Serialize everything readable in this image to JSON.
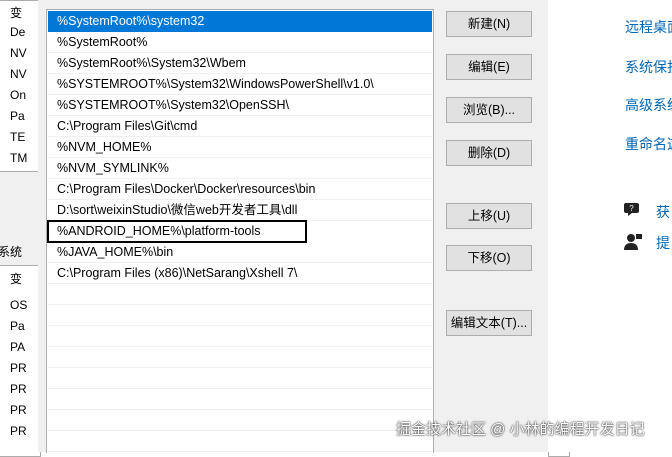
{
  "background_window": {
    "top_rows": [
      "变",
      "De",
      "NV",
      "NV",
      "On",
      "Pa",
      "TE",
      "TM"
    ],
    "section_label": "系统",
    "bottom_rows": [
      "变",
      "OS",
      "Pa",
      "PA",
      "PR",
      "PR",
      "PR",
      "PR"
    ]
  },
  "dialog": {
    "path_entries": [
      "%SystemRoot%\\system32",
      "%SystemRoot%",
      "%SystemRoot%\\System32\\Wbem",
      "%SYSTEMROOT%\\System32\\WindowsPowerShell\\v1.0\\",
      "%SYSTEMROOT%\\System32\\OpenSSH\\",
      "C:\\Program Files\\Git\\cmd",
      "%NVM_HOME%",
      "%NVM_SYMLINK%",
      "C:\\Program Files\\Docker\\Docker\\resources\\bin",
      "D:\\sort\\weixinStudio\\微信web开发者工具\\dll",
      "%ANDROID_HOME%\\platform-tools",
      "%JAVA_HOME%\\bin",
      "C:\\Program Files (x86)\\NetSarang\\Xshell 7\\"
    ],
    "selected_index": 0,
    "outlined_index": 10,
    "buttons": {
      "new": "新建(N)",
      "edit": "编辑(E)",
      "browse": "浏览(B)...",
      "delete": "删除(D)",
      "move_up": "上移(U)",
      "move_down": "下移(O)",
      "edit_text": "编辑文本(T)..."
    }
  },
  "right_panel": {
    "links": [
      "远程桌面",
      "系统保护",
      "高级系统",
      "重命名这"
    ],
    "help_items": [
      {
        "icon": "chat-help-icon",
        "label": "获"
      },
      {
        "icon": "person-feedback-icon",
        "label": "提"
      }
    ]
  },
  "watermark": "掘金技术社区 @ 小林的编程开发日记",
  "colors": {
    "selection": "#0078d7",
    "link": "#0066b4",
    "dialog_bg": "#f0f0f0"
  }
}
